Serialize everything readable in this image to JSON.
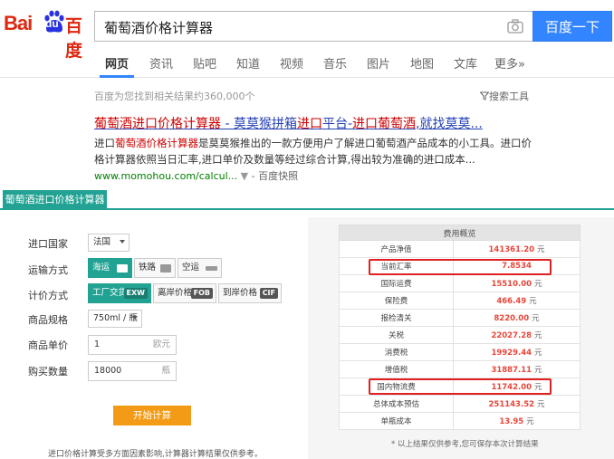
{
  "header": {
    "logo": {
      "bai": "Bai",
      "du": "du",
      "cn": "百度"
    },
    "query": "葡萄酒价格计算器",
    "search_button": "百度一下"
  },
  "nav": {
    "items": [
      "网页",
      "资讯",
      "贴吧",
      "知道",
      "视频",
      "音乐",
      "图片",
      "地图",
      "文库",
      "更多»"
    ],
    "active": "网页"
  },
  "results": {
    "count_text": "百度为您找到相关结果约360,000个",
    "tools_label": "搜索工具",
    "title_parts": [
      "葡萄酒",
      "进口",
      "价格",
      "计算器",
      " - 莫莫猴拼箱",
      "进口",
      "平台-",
      "进口",
      "葡萄酒",
      ",就找莫莫..."
    ],
    "abstract_parts": [
      "进口",
      "葡萄酒价格计算器",
      "是莫莫猴推出的一款方便用户了解进口葡萄酒产品成本的小工具。进口价格计算器依照当日汇率,进口单价及数量等经过综合计算,得出较为准确的进口成本..."
    ],
    "url": "www.momohou.com/calcul...",
    "url_arrow": "▼",
    "snapshot": "- 百度快照"
  },
  "calculator": {
    "tab_label": "葡萄酒进口价格计算器",
    "labels": {
      "country": "进口国家",
      "transport": "运输方式",
      "pricing": "计价方式",
      "spec": "商品规格",
      "unit_price": "商品单价",
      "quantity": "购买数量"
    },
    "country_value": "法国",
    "transport_options": [
      "海运",
      "铁路",
      "空运"
    ],
    "transport_selected": "海运",
    "pricing_options": [
      {
        "label": "工厂交货",
        "tag": "EXW"
      },
      {
        "label": "离岸价格",
        "tag": "FOB"
      },
      {
        "label": "到岸价格",
        "tag": "CIF"
      }
    ],
    "pricing_selected": "工厂交货",
    "spec_value": "750ml / 瓶",
    "unit_price_value": "1",
    "unit_price_unit": "欧元",
    "quantity_value": "18000",
    "quantity_unit": "瓶",
    "start_button": "开始计算",
    "note": "进口价格计算受多方面因素影响,计算器计算结果仅供参考。"
  },
  "summary": {
    "header": "费用概览",
    "rows": [
      {
        "key": "产品净值",
        "value": "141361.20",
        "unit": "元"
      },
      {
        "key": "当前汇率",
        "value": "7.8534",
        "unit": ""
      },
      {
        "key": "国际运费",
        "value": "15510.00",
        "unit": "元"
      },
      {
        "key": "保险费",
        "value": "466.49",
        "unit": "元"
      },
      {
        "key": "报检清关",
        "value": "8220.00",
        "unit": "元"
      },
      {
        "key": "关税",
        "value": "22027.28",
        "unit": "元"
      },
      {
        "key": "消费税",
        "value": "19929.44",
        "unit": "元"
      },
      {
        "key": "增值税",
        "value": "31887.11",
        "unit": "元"
      },
      {
        "key": "国内物流费",
        "value": "11742.00",
        "unit": "元"
      },
      {
        "key": "总体成本预估",
        "value": "251143.52",
        "unit": "元"
      },
      {
        "key": "单瓶成本",
        "value": "13.95",
        "unit": "元"
      }
    ],
    "note": "* 以上结果仅供参考,您可保存本次计算结果"
  },
  "colors": {
    "accent": "#22a293",
    "baidu_red": "#de2810",
    "baidu_blue": "#3385ff",
    "highlight_red": "#e02020",
    "value_red": "#e8463a",
    "button_orange": "#f39b16"
  }
}
